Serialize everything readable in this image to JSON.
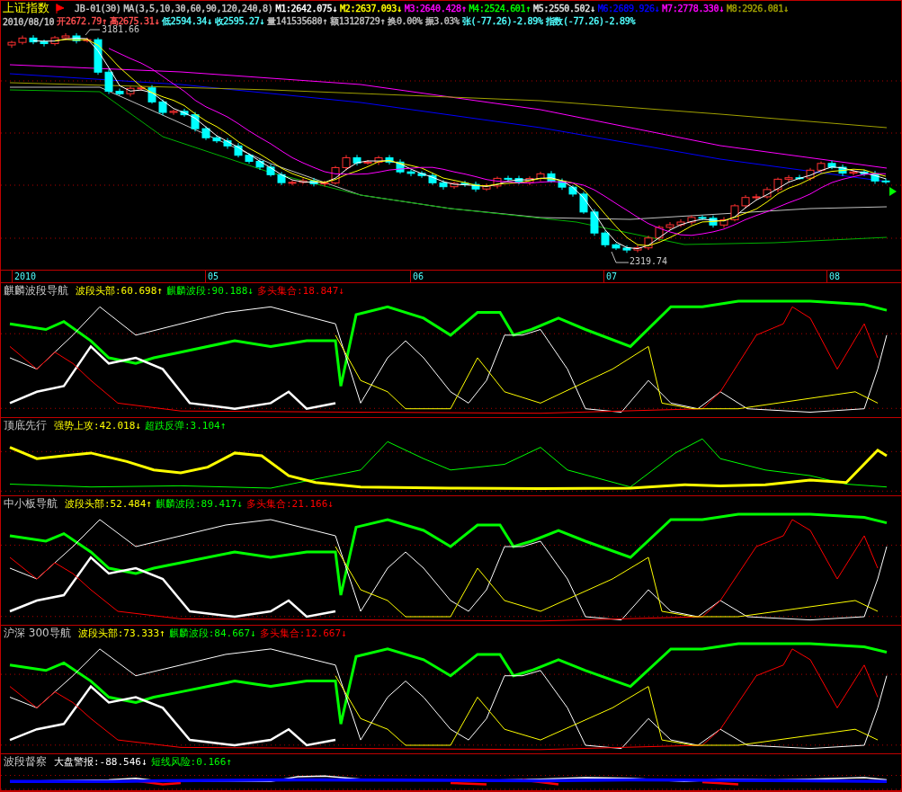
{
  "header": {
    "title": "上证指数",
    "formula": "JB-01(30)",
    "ma_params": "MA(3,5,10,30,60,90,120,240,8)",
    "ma_values": [
      {
        "text": "M1:2642.075",
        "arrow": "↓",
        "color": "#ffffff"
      },
      {
        "text": "M2:2637.093",
        "arrow": "↓",
        "color": "#ffff00"
      },
      {
        "text": "M3:2640.428",
        "arrow": "↑",
        "color": "#ff00ff"
      },
      {
        "text": "M4:2524.601",
        "arrow": "↑",
        "color": "#00ff00"
      },
      {
        "text": "M5:2550.502",
        "arrow": "↓",
        "color": "#e0e0e0"
      },
      {
        "text": "M6:2689.926",
        "arrow": "↓",
        "color": "#0000ff"
      },
      {
        "text": "M7:2778.330",
        "arrow": "↓",
        "color": "#ff00ff"
      },
      {
        "text": "M8:2926.081",
        "arrow": "↓",
        "color": "#a0a000"
      }
    ]
  },
  "quote": {
    "date": "2010/08/10",
    "items": [
      {
        "text": "开2672.79",
        "arrow": "↑",
        "color": "#ff5050"
      },
      {
        "text": "高2675.31",
        "arrow": "↓",
        "color": "#ff5050"
      },
      {
        "text": "低2594.34",
        "arrow": "↓",
        "color": "#50ffff"
      },
      {
        "text": "收2595.27",
        "arrow": "↓",
        "color": "#50ffff"
      },
      {
        "text": "量141535680",
        "arrow": "↑",
        "color": "#c0c0c0"
      },
      {
        "text": "额13128729",
        "arrow": "↑",
        "color": "#c0c0c0"
      },
      {
        "text": "换0.00%",
        "color": "#c0c0c0"
      },
      {
        "text": "振3.03%",
        "color": "#c0c0c0"
      },
      {
        "text": "张(-77.26)-2.89%",
        "color": "#50ffff"
      },
      {
        "text": "指数(-77.26)-2.89%",
        "color": "#50ffff"
      }
    ]
  },
  "main_chart": {
    "high_label": "3181.66",
    "low_label": "2319.74"
  },
  "time_axis": [
    "2010",
    "05",
    "06",
    "07",
    "08"
  ],
  "panels": [
    {
      "title": "麒麟波段导航",
      "items": [
        {
          "text": "波段头部:60.698",
          "arrow": "↑",
          "color": "#ffff00"
        },
        {
          "text": "麒麟波段:90.188",
          "arrow": "↓",
          "color": "#00ff00"
        },
        {
          "text": "多头集合:18.847",
          "arrow": "↓",
          "color": "#ff0000"
        }
      ]
    },
    {
      "title": "顶底先行",
      "items": [
        {
          "text": "强势上攻:42.018",
          "arrow": "↓",
          "color": "#ffff00"
        },
        {
          "text": "超跌反弹:3.104",
          "arrow": "↑",
          "color": "#00ff00"
        }
      ]
    },
    {
      "title": "中小板导航",
      "items": [
        {
          "text": "波段头部:52.484",
          "arrow": "↑",
          "color": "#ffff00"
        },
        {
          "text": "麒麟波段:89.417",
          "arrow": "↓",
          "color": "#00ff00"
        },
        {
          "text": "多头集合:21.166",
          "arrow": "↓",
          "color": "#ff0000"
        }
      ]
    },
    {
      "title": "沪深 300导航",
      "items": [
        {
          "text": "波段头部:73.333",
          "arrow": "↑",
          "color": "#ffff00"
        },
        {
          "text": "麒麟波段:84.667",
          "arrow": "↓",
          "color": "#00ff00"
        },
        {
          "text": "多头集合:12.667",
          "arrow": "↓",
          "color": "#ff0000"
        }
      ]
    },
    {
      "title": "波段督察",
      "items": [
        {
          "text": "大盘警报:-88.546",
          "arrow": "↓",
          "color": "#ffffff"
        },
        {
          "text": "短线风险:0.166",
          "arrow": "↑",
          "color": "#00ff00"
        }
      ]
    }
  ]
}
